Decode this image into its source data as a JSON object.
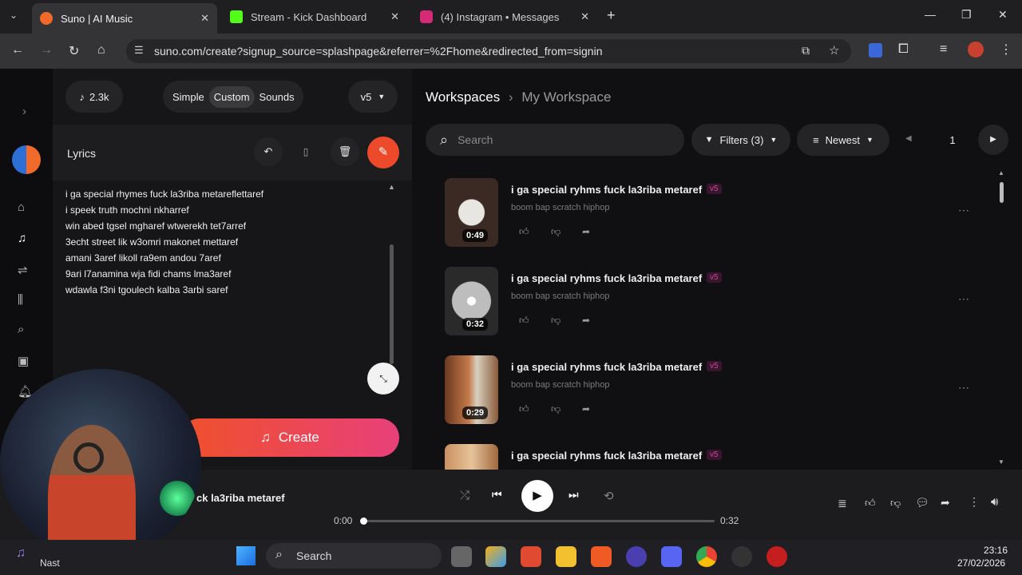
{
  "tabs": [
    {
      "title": "Suno | AI Music",
      "fav_color": "#f26a2a"
    },
    {
      "title": "Stream - Kick Dashboard",
      "fav_color": "#53fc18"
    },
    {
      "title": "(4) Instagram • Messages",
      "fav_color": "#d62976"
    }
  ],
  "url": "suno.com/create?signup_source=splashpage&referrer=%2Fhome&redirected_from=signin",
  "create": {
    "credits": "2.3k",
    "modes": [
      "Simple",
      "Custom",
      "Sounds"
    ],
    "active_mode": "Custom",
    "version": "v5",
    "lyrics_label": "Lyrics",
    "lyrics": [
      "i ga special rhymes fuck la3riba metareflettaref",
      "i speek truth mochni nkharref",
      "win abed tgsel mgharef wtwerekh tet7arref",
      "3echt street lik w3omri makonet mettaref",
      "amani 3aref likoll ra9em andou 7aref",
      "9ari l7anamina wja fidi chams lma3aref",
      "wdawla f3ni tgoulech kalba 3arbi saref"
    ],
    "create_label": "Create"
  },
  "workspace": {
    "breadcrumb_root": "Workspaces",
    "breadcrumb_current": "My Workspace",
    "search_placeholder": "Search",
    "filters_label": "Filters (3)",
    "sort_label": "Newest",
    "page": "1",
    "songs": [
      {
        "title": "i ga special ryhms fuck la3riba metaref",
        "tag": "v5",
        "genre": "boom bap scratch hiphop",
        "duration": "0:49"
      },
      {
        "title": "i ga special ryhms fuck la3riba metaref",
        "tag": "v5",
        "genre": "boom bap scratch hiphop",
        "duration": "0:32"
      },
      {
        "title": "i ga special ryhms fuck la3riba metaref",
        "tag": "v5",
        "genre": "boom bap scratch hiphop",
        "duration": "0:29"
      },
      {
        "title": "i ga special ryhms fuck la3riba metaref",
        "tag": "v5",
        "genre": "",
        "duration": ""
      }
    ]
  },
  "player": {
    "title": "ck la3riba metaref",
    "time_current": "0:00",
    "time_total": "0:32",
    "progress": 0
  },
  "taskbar": {
    "search_label": "Search",
    "user_label": "Nast",
    "time": "23:16",
    "date": "27/02/2026"
  }
}
